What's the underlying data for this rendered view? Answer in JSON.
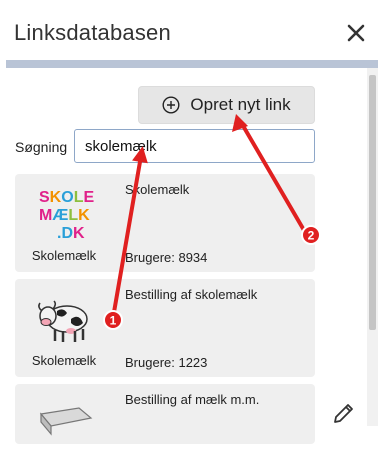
{
  "window": {
    "title": "Linksdatabasen",
    "close_icon": "close-icon"
  },
  "toolbar": {
    "add_label": "Opret nyt link",
    "add_icon": "plus-circle-icon"
  },
  "search": {
    "label": "Søgning",
    "value": "skolemælk"
  },
  "links": [
    {
      "title": "Skolemælk",
      "caption": "Skolemælk",
      "users": "Brugere: 8934",
      "logo_text": [
        "SKOLE",
        "MÆLK",
        ".DK"
      ]
    },
    {
      "title": "Bestilling af skolemælk",
      "caption": "Skolemælk",
      "users": "Brugere: 1223",
      "icon": "cow-icon"
    },
    {
      "title": "Bestilling af mælk m.m.",
      "icon": "tray-icon"
    }
  ],
  "annotations": [
    {
      "label": "1",
      "color": "#e02020"
    },
    {
      "label": "2",
      "color": "#e02020"
    }
  ],
  "colors": {
    "accent_bar": "#b9c4d6",
    "card_bg": "#efefef",
    "arrow": "#e02020"
  }
}
